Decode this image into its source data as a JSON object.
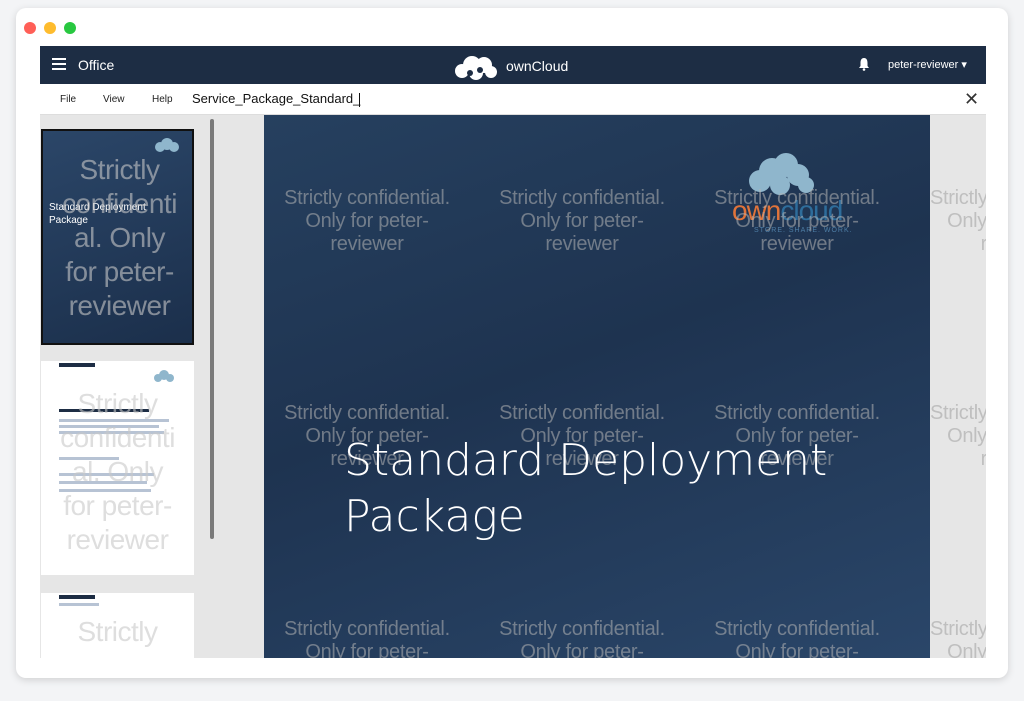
{
  "topbar": {
    "menu_label": "Office",
    "brand_name": "ownCloud",
    "user": "peter-reviewer ▾"
  },
  "menubar": {
    "file": "File",
    "view": "View",
    "help": "Help",
    "document_name": "Service_Package_Standard_",
    "close_symbol": "✕"
  },
  "sidebar": {
    "thumb1_title_line1": "Standard Deployment",
    "thumb1_title_line2": "Package",
    "thumb1_watermark": [
      "Strictly",
      "confidenti",
      "al. Only",
      "for peter-",
      "reviewer"
    ],
    "thumb2_watermark": [
      "Strictly",
      "confidenti",
      "al. Only",
      "for peter-",
      "reviewer"
    ],
    "thumb3_watermark": [
      "Strictly"
    ]
  },
  "slide": {
    "title_line1": "Standard Deployment",
    "title_line2": "Package",
    "logo_own": "own",
    "logo_cloud": "cloud",
    "logo_tagline": "STORE. SHARE. WORK.",
    "watermark_lines": [
      "Strictly confidential.",
      "Only for peter-",
      "reviewer"
    ],
    "watermark_partial": [
      "Strictly",
      "Only",
      "r"
    ]
  },
  "colors": {
    "topbar": "#1d2d44",
    "slide_background": "#1f3552",
    "logo_orange": "#e0733a",
    "logo_blue": "#2e6d9b"
  }
}
